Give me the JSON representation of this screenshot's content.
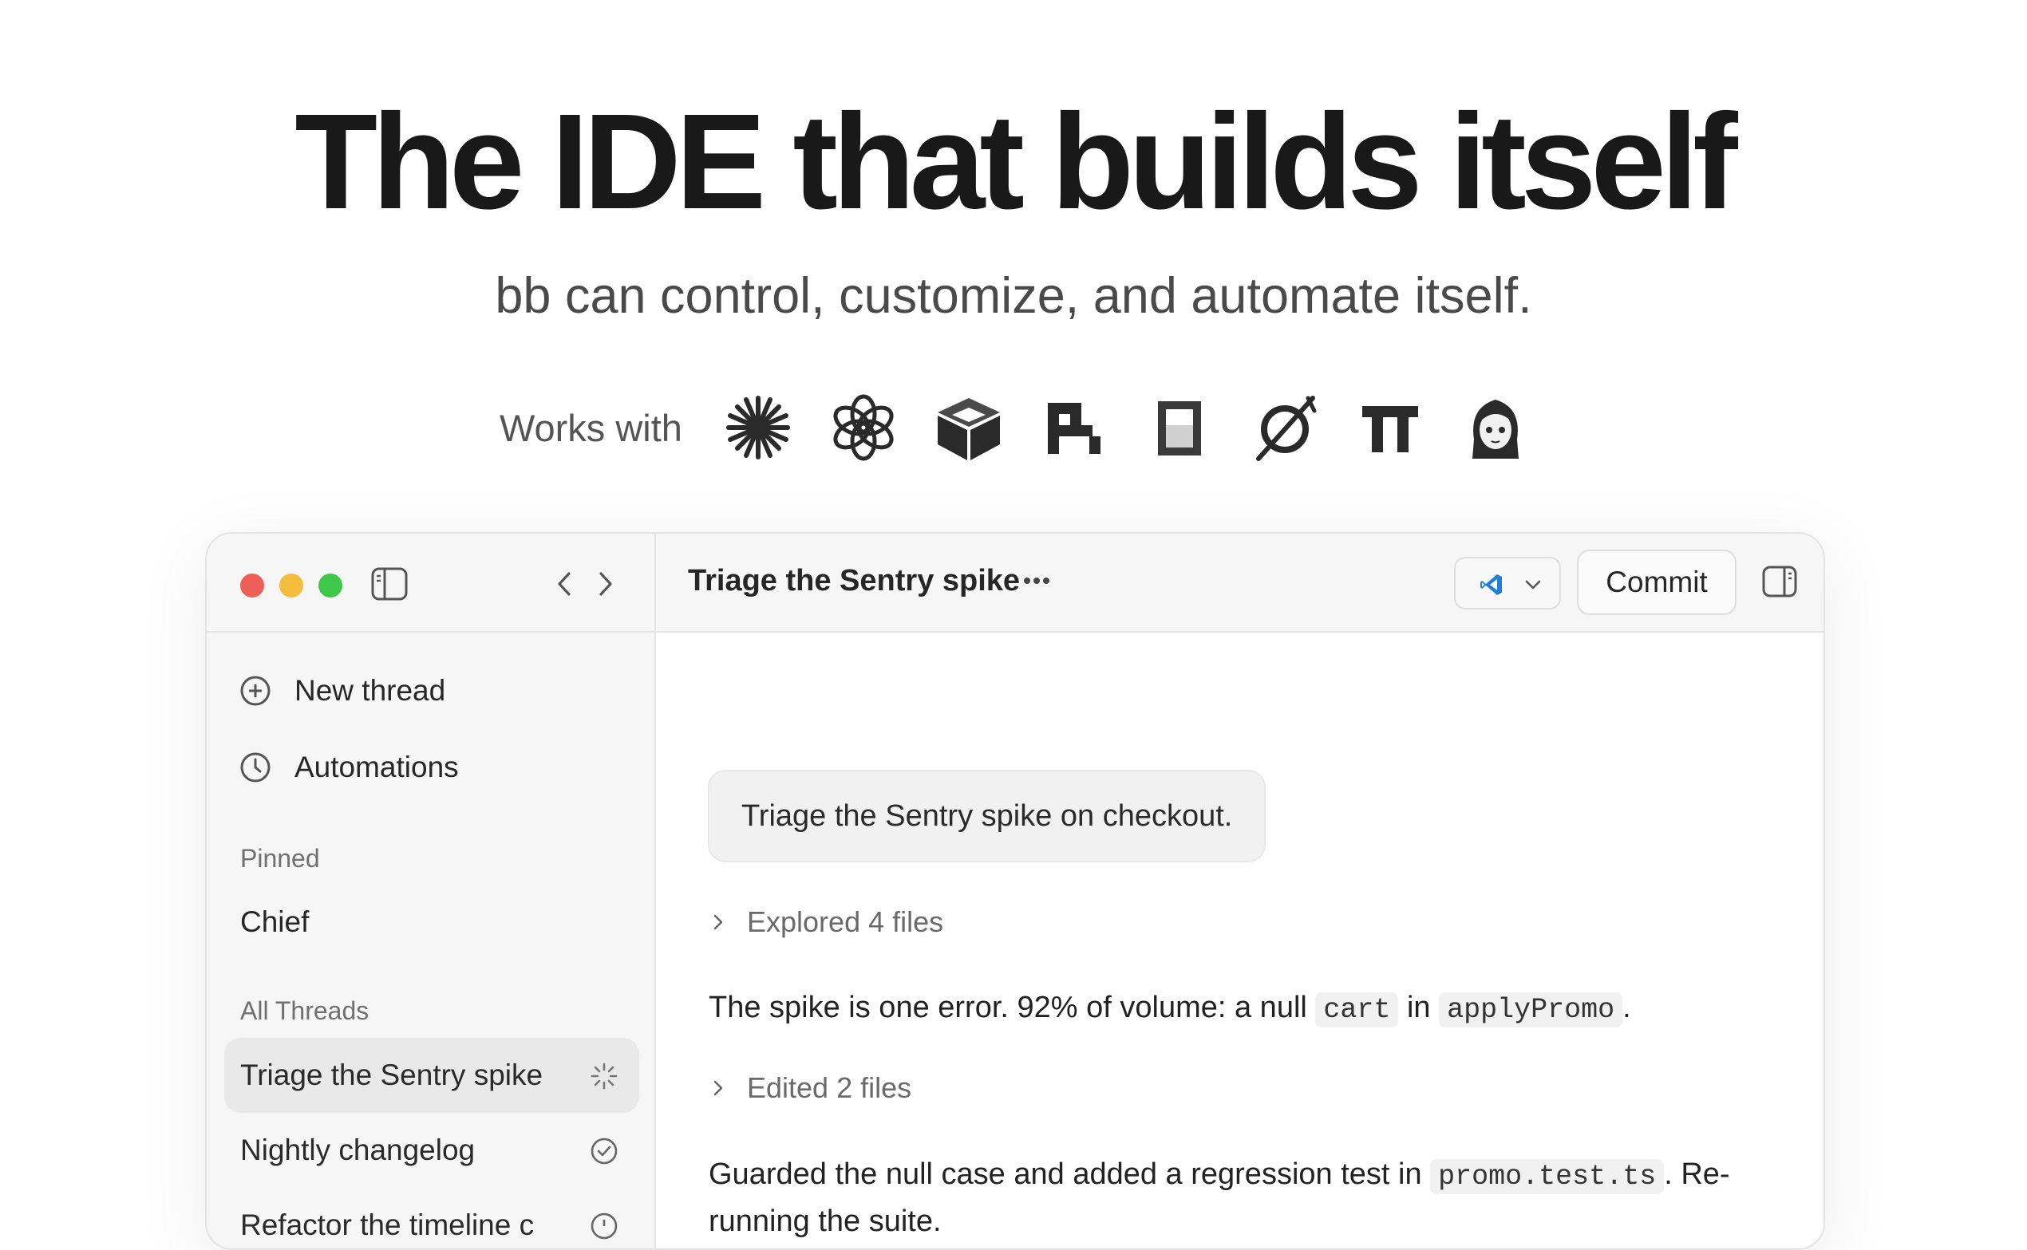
{
  "hero": {
    "title": "The IDE that builds itself",
    "subtitle": "bb can control, customize, and automate itself.",
    "works_with_label": "Works with",
    "logos": [
      "claude-logo-icon",
      "openai-logo-icon",
      "cube-logo-icon",
      "pixel-logo-icon",
      "square-logo-icon",
      "slash-circle-logo-icon",
      "pi-logo-icon",
      "anime-avatar-logo-icon"
    ]
  },
  "window": {
    "sidebar": {
      "new_thread": "New thread",
      "automations": "Automations",
      "pinned_label": "Pinned",
      "pinned_items": [
        "Chief"
      ],
      "all_threads_label": "All Threads",
      "threads": [
        {
          "label": "Triage the Sentry spike",
          "status": "running"
        },
        {
          "label": "Nightly changelog",
          "status": "done"
        },
        {
          "label": "Refactor the timeline c",
          "status": "other"
        }
      ]
    },
    "topbar": {
      "title": "Triage the Sentry spike",
      "editor_icon": "vscode-icon",
      "commit_label": "Commit"
    },
    "conversation": {
      "user_message": "Triage the Sentry spike on checkout.",
      "step1": "Explored 4 files",
      "msg1_prefix": "The spike is one error. 92% of volume: a null",
      "msg1_code1": "cart",
      "msg1_mid": "in",
      "msg1_code2": "applyPromo",
      "msg1_suffix": ".",
      "step2": "Edited 2 files",
      "msg2_prefix": "Guarded the null case and added a regression test in",
      "msg2_code": "promo.test.ts",
      "msg2_suffix": ". Re-running the suite."
    }
  },
  "colors": {
    "traffic_red": "#ed5f57",
    "traffic_yellow": "#f4bd3c",
    "traffic_green": "#3fc74a",
    "vscode_blue": "#1e7fd6"
  }
}
